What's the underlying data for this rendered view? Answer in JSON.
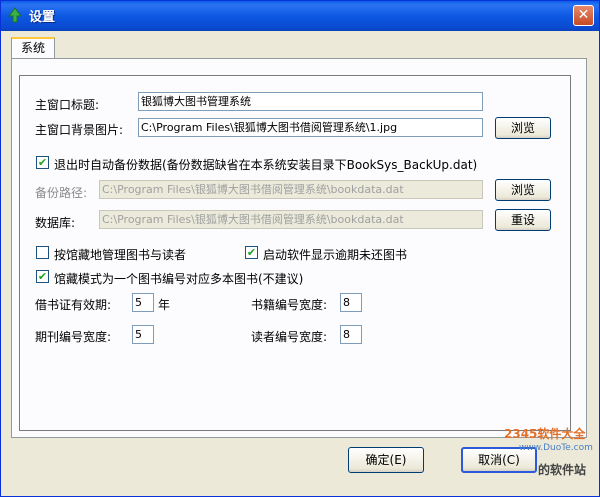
{
  "window": {
    "title": "设置"
  },
  "tabs": [
    {
      "label": "系统"
    }
  ],
  "fields": {
    "main_title_label": "主窗口标题:",
    "main_title_value": "银狐博大图书管理系统",
    "bg_image_label": "主窗口背景图片:",
    "bg_image_value": "C:\\Program Files\\银狐博大图书借阅管理系统\\1.jpg",
    "browse_label": "浏览",
    "auto_backup_label": "退出时自动备份数据(备份数据缺省在本系统安装目录下BookSys_BackUp.dat)",
    "auto_backup_checked": true,
    "backup_path_label": "备份路径:",
    "backup_path_value": "C:\\Program Files\\银狐博大图书借阅管理系统\\bookdata.dat",
    "database_label": "数据库:",
    "database_value": "C:\\Program Files\\银狐博大图书借阅管理系统\\bookdata.dat",
    "reset_label": "重设",
    "by_location_label": "按馆藏地管理图书与读者",
    "by_location_checked": false,
    "show_overdue_label": "启动软件显示逾期未还图书",
    "show_overdue_checked": true,
    "multi_copy_label": "馆藏模式为一个图书编号对应多本图书(不建议)",
    "multi_copy_checked": true,
    "card_validity_label": "借书证有效期:",
    "card_validity_value": "5",
    "card_validity_unit": "年",
    "book_id_width_label": "书籍编号宽度:",
    "book_id_width_value": "8",
    "periodical_id_width_label": "期刊编号宽度:",
    "periodical_id_width_value": "5",
    "reader_id_width_label": "读者编号宽度:",
    "reader_id_width_value": "8"
  },
  "buttons": {
    "ok": "确定(E)",
    "cancel": "取消(C)"
  },
  "watermarks": {
    "site": "2345软件大全",
    "url": "www.DuoTe.com",
    "footer": "的软件站"
  },
  "icons": {
    "app": "tree-icon",
    "close": "close-icon",
    "check": "check-icon"
  }
}
